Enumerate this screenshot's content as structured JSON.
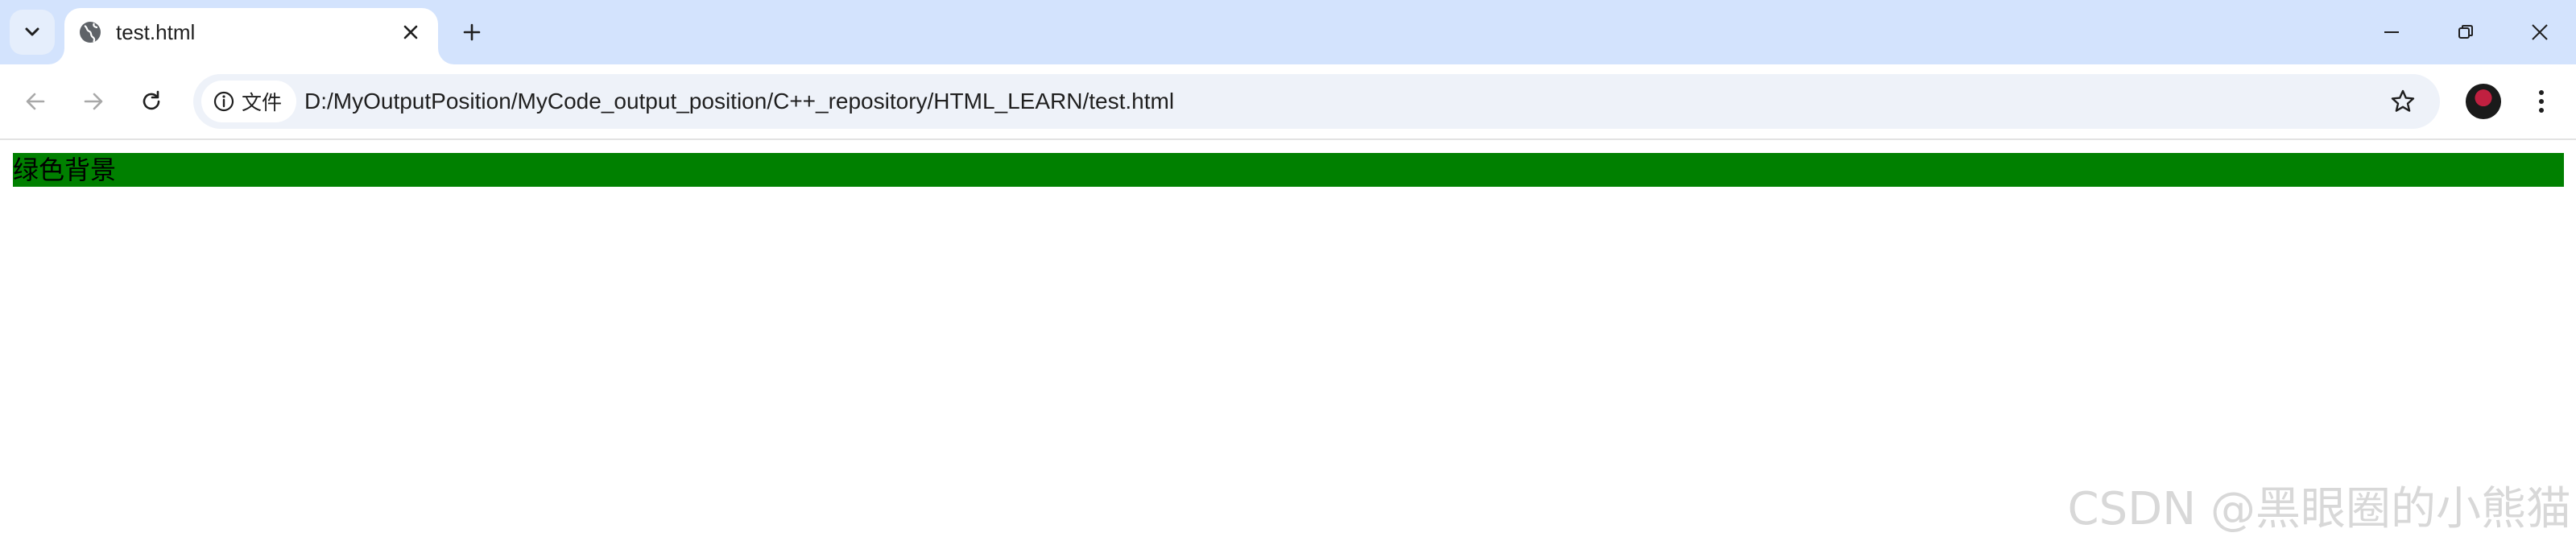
{
  "tab": {
    "title": "test.html"
  },
  "toolbar": {
    "site_chip_label": "文件",
    "url": "D:/MyOutputPosition/MyCode_output_position/C++_repository/HTML_LEARN/test.html"
  },
  "page": {
    "green_text": "绿色背景",
    "background_color": "#008000"
  },
  "watermark": "CSDN @黑眼圈的小熊猫",
  "icons": {
    "tab_search": "chevron-down-icon",
    "favicon": "globe-icon",
    "tab_close": "close-icon",
    "new_tab": "plus-icon",
    "minimize": "minimize-icon",
    "restore": "restore-icon",
    "close_window": "close-icon",
    "back": "arrow-left-icon",
    "forward": "arrow-right-icon",
    "reload": "reload-icon",
    "info": "info-icon",
    "bookmark": "star-icon",
    "menu": "kebab-icon"
  },
  "colors": {
    "tabstrip": "#d3e3fd",
    "omnibox": "#eef2f9"
  }
}
